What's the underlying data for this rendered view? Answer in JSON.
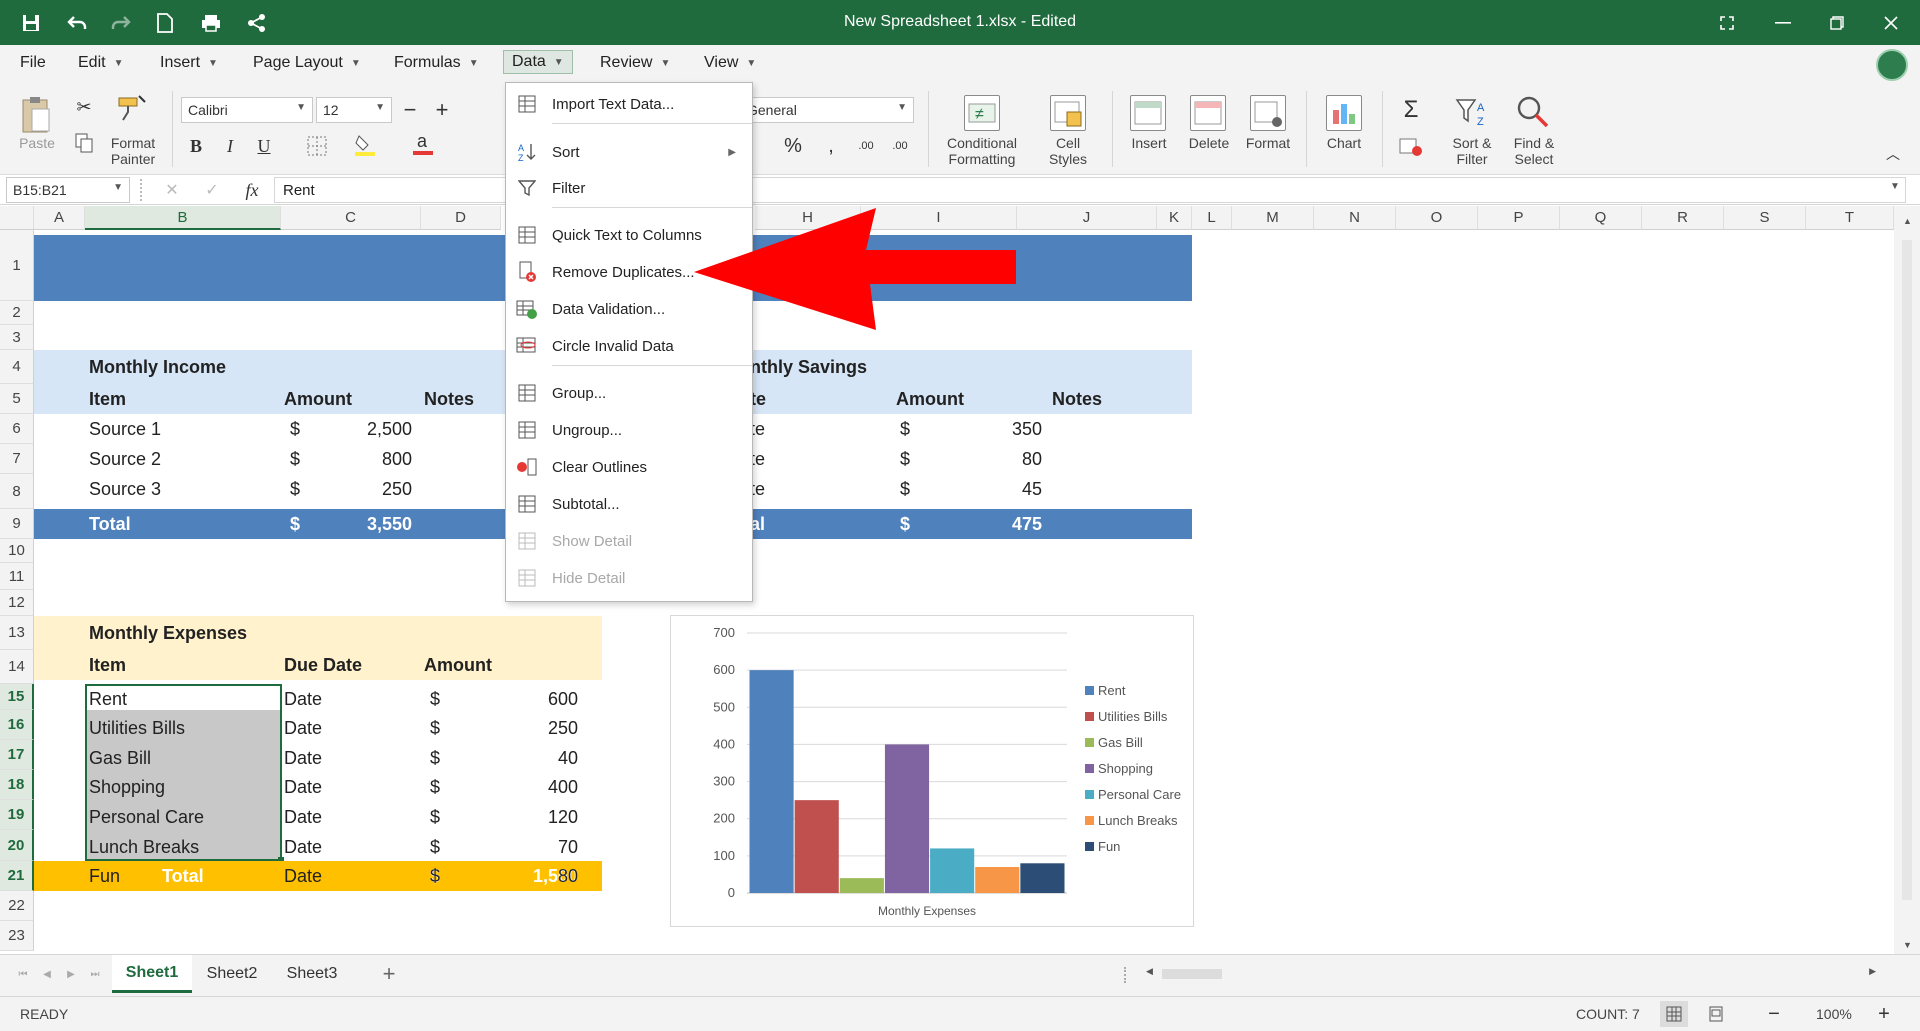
{
  "window": {
    "title": "New Spreadsheet 1.xlsx - Edited"
  },
  "menus": [
    "File",
    "Edit",
    "Insert",
    "Page Layout",
    "Formulas",
    "Data",
    "Review",
    "View"
  ],
  "ribbon": {
    "paste": "Paste",
    "format_painter_1": "Format",
    "format_painter_2": "Painter",
    "font_name": "Calibri",
    "font_size": "12",
    "number_format": "General",
    "conditional_1": "Conditional",
    "conditional_2": "Formatting",
    "cell_styles_1": "Cell",
    "cell_styles_2": "Styles",
    "insert": "Insert",
    "delete": "Delete",
    "format": "Format",
    "chart": "Chart",
    "sort_filter_1": "Sort &",
    "sort_filter_2": "Filter",
    "find_select_1": "Find &",
    "find_select_2": "Select"
  },
  "formula_bar": {
    "name_box": "B15:B21",
    "content": "Rent"
  },
  "columns": [
    "A",
    "B",
    "C",
    "D",
    "E",
    "F",
    "G",
    "H",
    "I",
    "J",
    "K",
    "L",
    "M",
    "N",
    "O",
    "P",
    "Q",
    "R",
    "S",
    "T"
  ],
  "rows": [
    "1",
    "2",
    "3",
    "4",
    "5",
    "6",
    "7",
    "8",
    "9",
    "10",
    "11",
    "12",
    "13",
    "14",
    "15",
    "16",
    "17",
    "18",
    "19",
    "20",
    "21",
    "22",
    "23"
  ],
  "income": {
    "title": "Monthly Income",
    "headers": [
      "Item",
      "Amount",
      "Notes"
    ],
    "rows": [
      {
        "item": "Source 1",
        "cur": "$",
        "amount": "2,500"
      },
      {
        "item": "Source 2",
        "cur": "$",
        "amount": "800"
      },
      {
        "item": "Source 3",
        "cur": "$",
        "amount": "250"
      }
    ],
    "total": {
      "label": "Total",
      "cur": "$",
      "amount": "3,550"
    }
  },
  "savings": {
    "title_partial": "nthly Savings",
    "headers_partial": "te",
    "amount_header": "Amount",
    "notes_header": "Notes",
    "rows": [
      {
        "item": "te",
        "cur": "$",
        "amount": "350"
      },
      {
        "item": "te",
        "cur": "$",
        "amount": "80"
      },
      {
        "item": "te",
        "cur": "$",
        "amount": "45"
      }
    ],
    "total": {
      "label": "al",
      "cur": "$",
      "amount": "475"
    }
  },
  "expenses": {
    "title": "Monthly Expenses",
    "headers": [
      "Item",
      "Due Date",
      "Amount"
    ],
    "rows": [
      {
        "item": "Rent",
        "due": "Date",
        "cur": "$",
        "amount": "600"
      },
      {
        "item": "Utilities Bills",
        "due": "Date",
        "cur": "$",
        "amount": "250"
      },
      {
        "item": "Gas Bill",
        "due": "Date",
        "cur": "$",
        "amount": "40"
      },
      {
        "item": "Shopping",
        "due": "Date",
        "cur": "$",
        "amount": "400"
      },
      {
        "item": "Personal Care",
        "due": "Date",
        "cur": "$",
        "amount": "120"
      },
      {
        "item": "Lunch Breaks",
        "due": "Date",
        "cur": "$",
        "amount": "70"
      },
      {
        "item": "Fun",
        "due": "Date",
        "cur": "$",
        "amount": "80"
      }
    ],
    "total": {
      "label": "Total",
      "cur": "$",
      "amount": "1,560"
    }
  },
  "data_menu": {
    "items": [
      {
        "label": "Import Text Data...",
        "icon": "import-text-icon",
        "enabled": true
      },
      {
        "label": "Sort",
        "icon": "sort-az-icon",
        "enabled": true,
        "submenu": true
      },
      {
        "label": "Filter",
        "icon": "filter-icon",
        "enabled": true
      },
      {
        "label": "Quick Text to Columns",
        "icon": "text-to-columns-icon",
        "enabled": true
      },
      {
        "label": "Remove Duplicates...",
        "icon": "remove-duplicates-icon",
        "enabled": true
      },
      {
        "label": "Data Validation...",
        "icon": "data-validation-icon",
        "enabled": true
      },
      {
        "label": "Circle Invalid Data",
        "icon": "circle-invalid-icon",
        "enabled": true
      },
      {
        "label": "Group...",
        "icon": "group-icon",
        "enabled": true
      },
      {
        "label": "Ungroup...",
        "icon": "ungroup-icon",
        "enabled": true
      },
      {
        "label": "Clear Outlines",
        "icon": "clear-outlines-icon",
        "enabled": true
      },
      {
        "label": "Subtotal...",
        "icon": "subtotal-icon",
        "enabled": true
      },
      {
        "label": "Show Detail",
        "icon": "show-detail-icon",
        "enabled": false
      },
      {
        "label": "Hide Detail",
        "icon": "hide-detail-icon",
        "enabled": false
      }
    ]
  },
  "chart_data": {
    "type": "bar",
    "categories": [
      "Rent",
      "Utilities Bills",
      "Gas Bill",
      "Shopping",
      "Personal Care",
      "Lunch Breaks",
      "Fun"
    ],
    "values": [
      600,
      250,
      40,
      400,
      120,
      70,
      80
    ],
    "colors": [
      "#4f81bd",
      "#c0504d",
      "#9bbb59",
      "#8064a2",
      "#4bacc6",
      "#f79646",
      "#2c4d75"
    ],
    "title": "",
    "xlabel": "Monthly Expenses",
    "ylabel": "",
    "ylim": [
      0,
      700
    ],
    "yticks": [
      "0",
      "100",
      "200",
      "300",
      "400",
      "500",
      "600",
      "700"
    ],
    "grid": true,
    "legend": "right"
  },
  "sheets": [
    "Sheet1",
    "Sheet2",
    "Sheet3"
  ],
  "status": {
    "mode": "READY",
    "count": "COUNT: 7",
    "zoom": "100%"
  },
  "colors": {
    "brand": "#1f6b3e",
    "income_band": "#4f81bd",
    "header_band": "#d6e6f7",
    "expense_band": "#fff2cc",
    "expense_total": "#ffc000",
    "arrow": "#ff0000"
  }
}
